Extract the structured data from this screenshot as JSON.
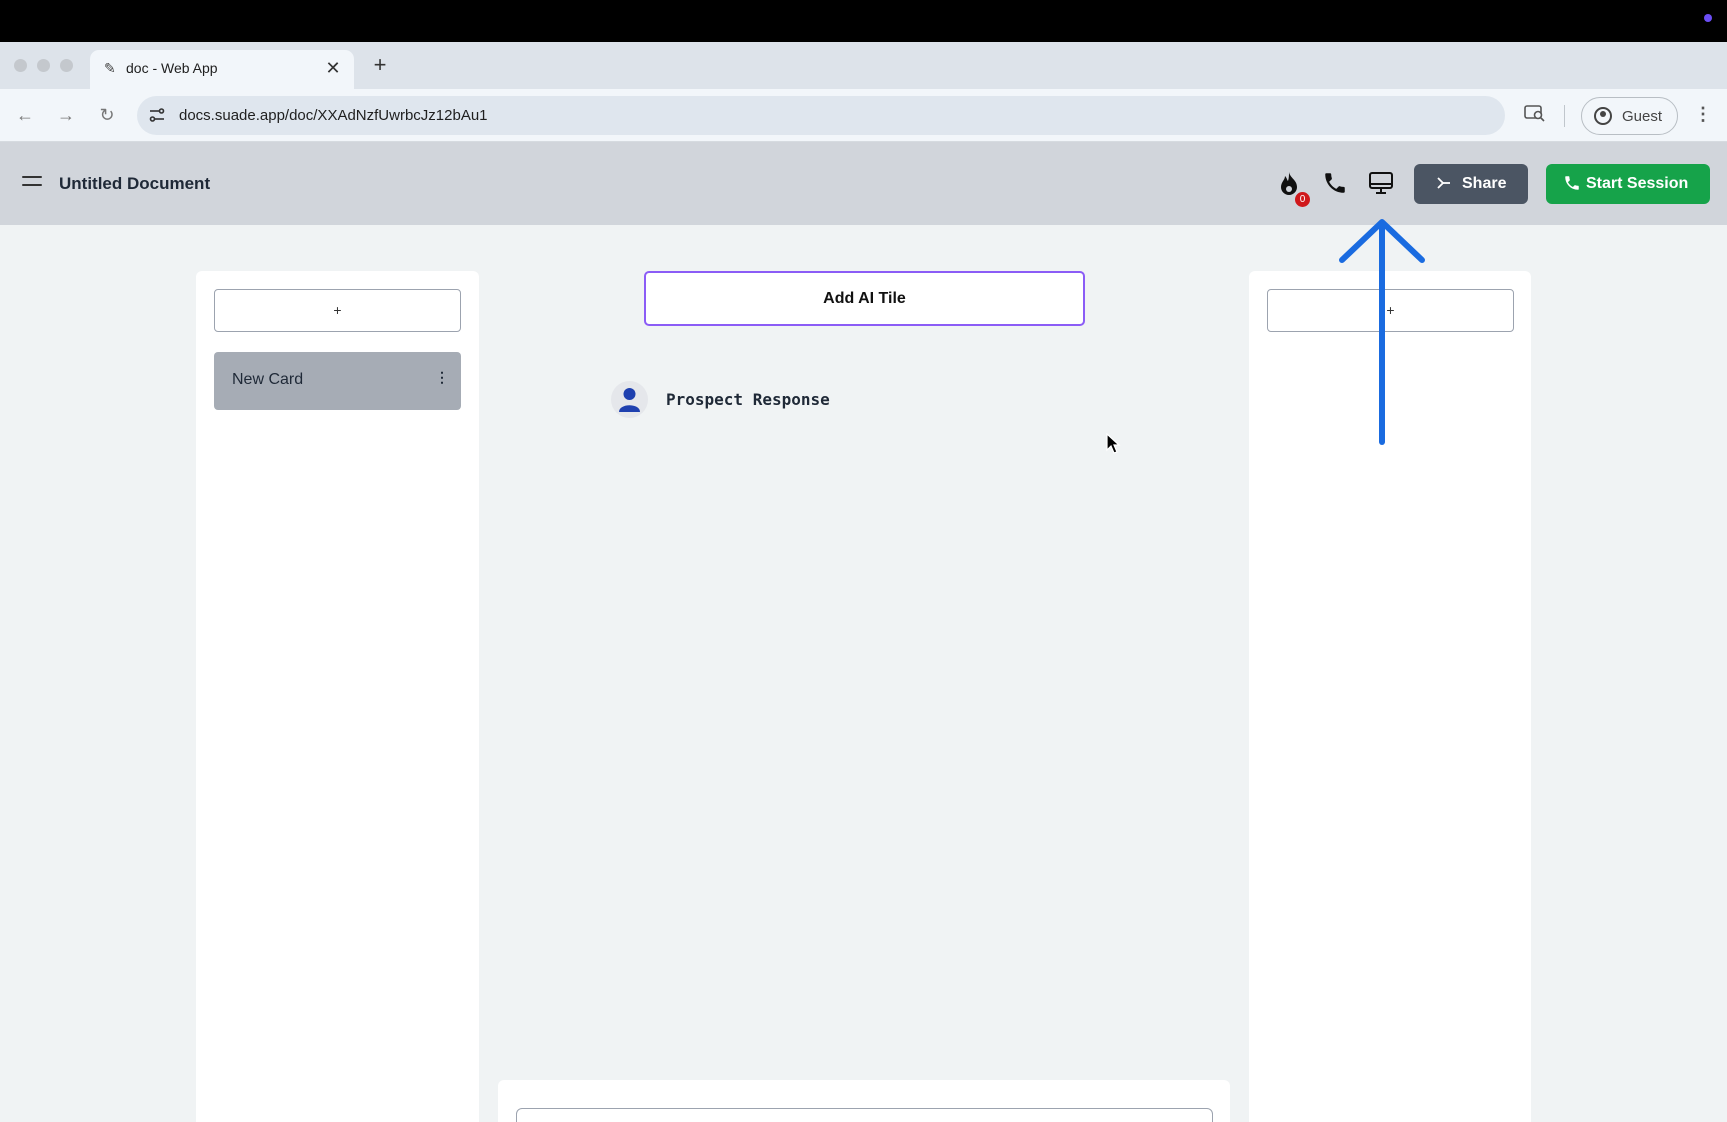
{
  "browser": {
    "tab_title": "doc - Web App",
    "new_tab_symbol": "+",
    "url": "docs.suade.app/doc/XXAdNzfUwrbcJz12bAu1",
    "profile_label": "Guest"
  },
  "app": {
    "document_title": "Untitled Document",
    "streak_count": "0",
    "share_label": "Share",
    "start_session_label": "Start Session",
    "icons": [
      "menu-icon",
      "fire-icon",
      "phone-icon",
      "monitor-icon",
      "share-arrow-icon",
      "phone-icon"
    ]
  },
  "left_column": {
    "add_label": "+",
    "cards": [
      {
        "label": "New Card",
        "menu_symbol": "⋮"
      }
    ]
  },
  "center": {
    "add_ai_tile_label": "Add AI Tile",
    "prospect_label": "Prospect Response"
  },
  "right_column": {
    "add_label": "+"
  },
  "colors": {
    "header_bg": "#d1d5db",
    "share_bg": "#4b5563",
    "start_session_bg": "#16a34a",
    "ai_tile_border": "#8b5cf6",
    "annotation_arrow": "#1a6be0",
    "badge": "#d0181b"
  }
}
